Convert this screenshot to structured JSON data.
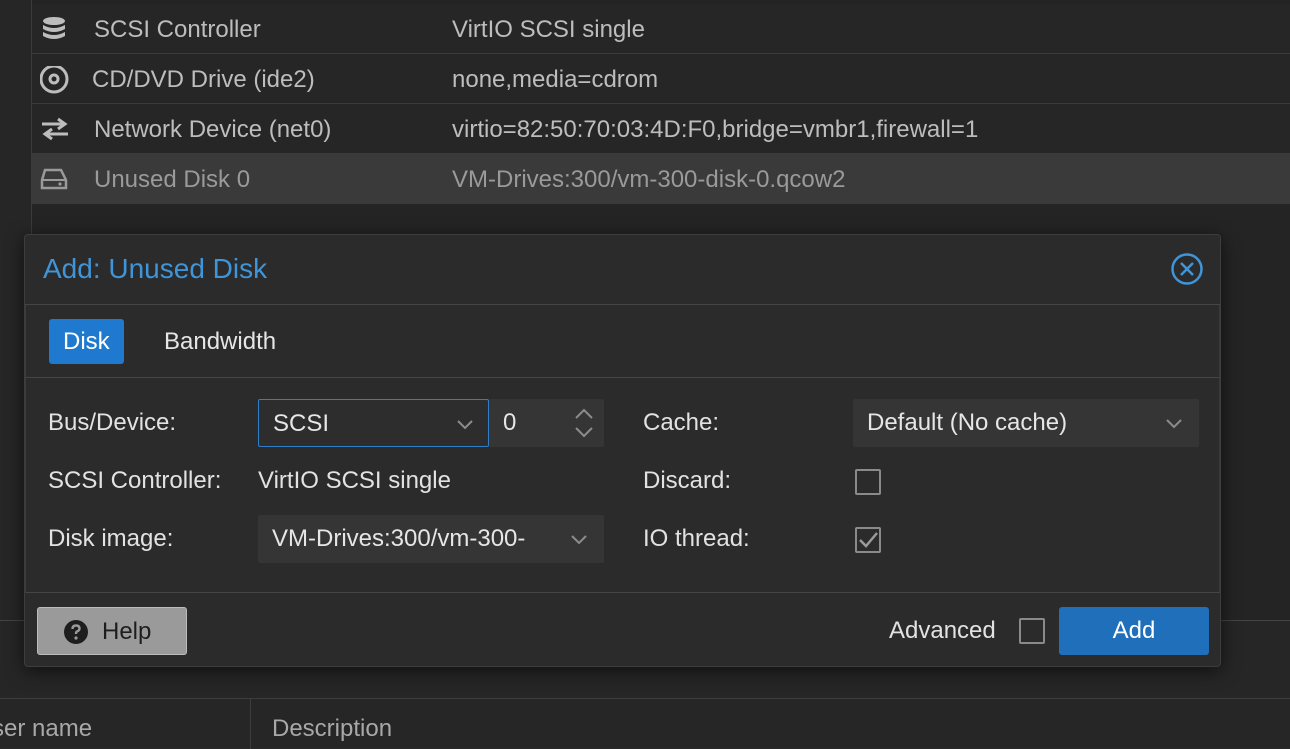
{
  "hardware_list": [
    {
      "icon": "database-icon",
      "name": "SCSI Controller",
      "value": "VirtIO SCSI single",
      "selected": false
    },
    {
      "icon": "cdrom-icon",
      "name": "CD/DVD Drive (ide2)",
      "value": "none,media=cdrom",
      "selected": false
    },
    {
      "icon": "network-arrows-icon",
      "name": "Network Device (net0)",
      "value": "virtio=82:50:70:03:4D:F0,bridge=vmbr1,firewall=1",
      "selected": false
    },
    {
      "icon": "hard-drive-icon",
      "name": "Unused Disk 0",
      "value": "VM-Drives:300/vm-300-disk-0.qcow2",
      "selected": true
    }
  ],
  "modal": {
    "title": "Add: Unused Disk",
    "tabs": [
      {
        "label": "Disk",
        "active": true
      },
      {
        "label": "Bandwidth",
        "active": false
      }
    ],
    "form": {
      "bus_device_label": "Bus/Device:",
      "bus_value": "SCSI",
      "device_number": "0",
      "scsi_controller_label": "SCSI Controller:",
      "scsi_controller_value": "VirtIO SCSI single",
      "disk_image_label": "Disk image:",
      "disk_image_value": "VM-Drives:300/vm-300-",
      "cache_label": "Cache:",
      "cache_value": "Default (No cache)",
      "discard_label": "Discard:",
      "discard_checked": false,
      "io_thread_label": "IO thread:",
      "io_thread_checked": true
    },
    "footer": {
      "help_label": "Help",
      "advanced_label": "Advanced",
      "advanced_checked": false,
      "add_label": "Add"
    }
  },
  "bottom_table": {
    "columns": [
      "ser name",
      "Description"
    ]
  },
  "colors": {
    "accent": "#1f79cf",
    "title": "#3f95d9",
    "add_button": "#1f6fba"
  }
}
